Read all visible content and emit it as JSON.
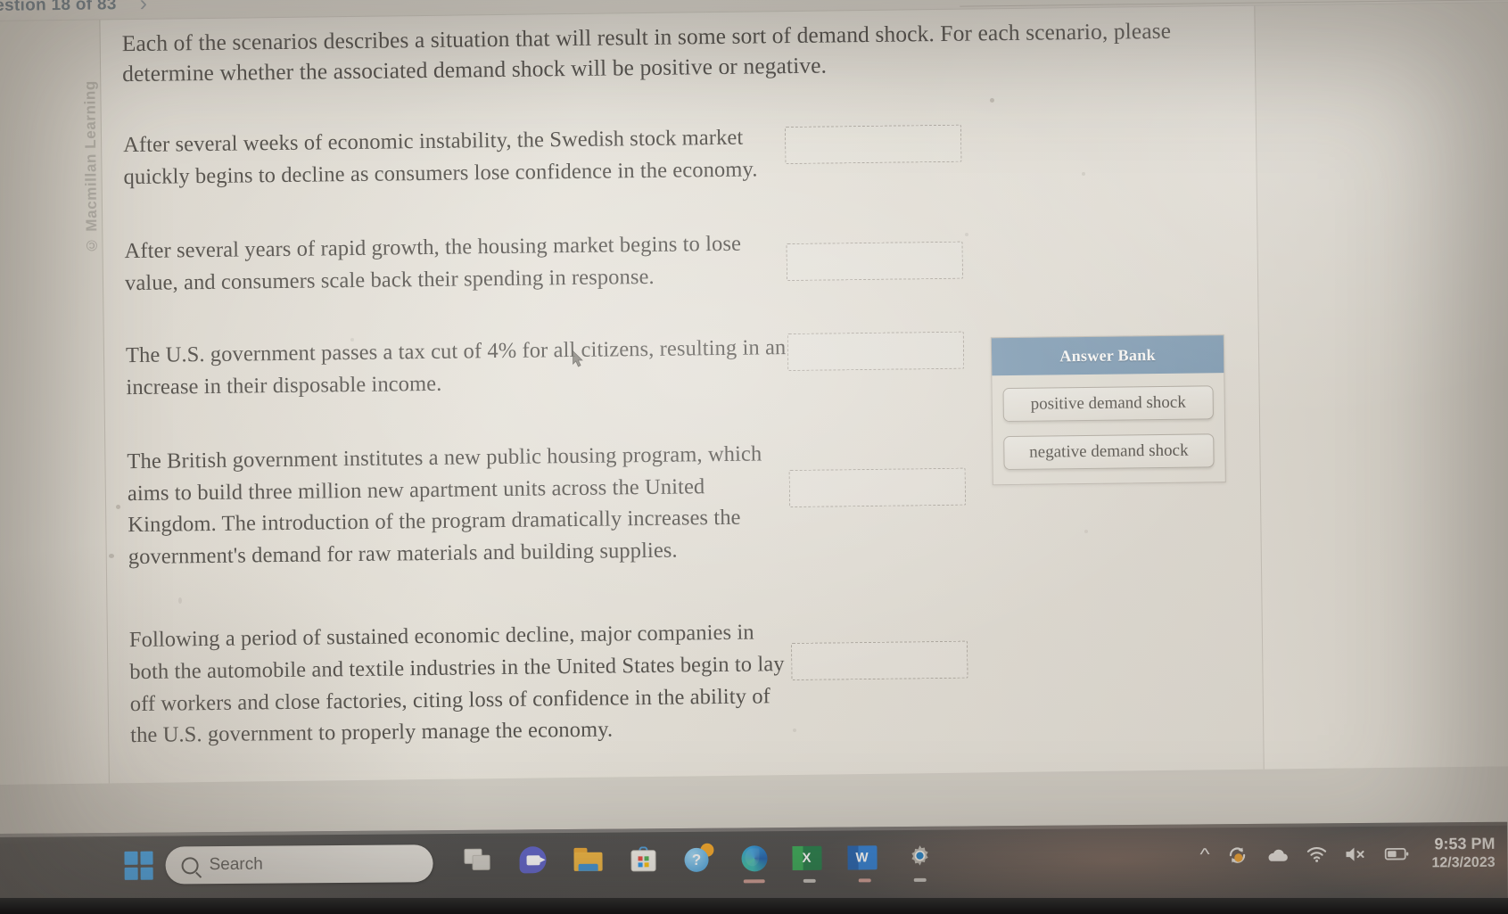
{
  "header": {
    "question_counter": "estion 18 of 83",
    "next_icon": "chevron-right-icon"
  },
  "watermark": "© Macmillan Learning",
  "question": {
    "intro": "Each of the scenarios describes a situation that will result in some sort of demand shock. For each scenario, please determine whether the associated demand shock will be positive or negative.",
    "scenarios": [
      {
        "text": "After several weeks of economic instability, the Swedish stock market quickly begins to decline as consumers lose confidence in the economy.",
        "answer": ""
      },
      {
        "text": "After several years of rapid growth, the housing market begins to lose value, and consumers scale back their spending in response.",
        "answer": ""
      },
      {
        "text": "The U.S. government passes a tax cut of 4% for all citizens, resulting in an increase in their disposable income.",
        "answer": ""
      },
      {
        "text": "The British government institutes a new public housing program, which aims to build three million new apartment units across the United Kingdom. The introduction of the program dramatically increases the government's demand for raw materials and building supplies.",
        "answer": ""
      },
      {
        "text": "Following a period of sustained economic decline, major companies in both the automobile and textile industries in the United States begin to lay off workers and close factories, citing loss of confidence in the ability of the U.S. government to properly manage the economy.",
        "answer": ""
      }
    ]
  },
  "answer_bank": {
    "title": "Answer Bank",
    "header_color": "#7e9cb5",
    "options": [
      "positive demand shock",
      "negative demand shock"
    ]
  },
  "taskbar": {
    "start_icon": "windows-logo-icon",
    "search": {
      "icon": "search-icon",
      "placeholder": "Search",
      "value": "Search"
    },
    "pinned": [
      {
        "name": "task-view-icon",
        "label": "Task View"
      },
      {
        "name": "chat-icon",
        "label": "Chat"
      },
      {
        "name": "file-explorer-icon",
        "label": "File Explorer"
      },
      {
        "name": "microsoft-store-icon",
        "label": "Microsoft Store"
      },
      {
        "name": "get-help-icon",
        "label": "Get Help"
      },
      {
        "name": "edge-icon",
        "label": "Microsoft Edge"
      },
      {
        "name": "excel-icon",
        "label": "Excel"
      },
      {
        "name": "word-icon",
        "label": "Word"
      },
      {
        "name": "settings-gear-icon",
        "label": "Settings"
      }
    ],
    "tray": {
      "overflow_icon": "chevron-up-icon",
      "update_icon": "sync-update-icon",
      "onedrive_icon": "cloud-icon",
      "wifi_icon": "wifi-icon",
      "volume_icon": "speaker-muted-icon",
      "battery_icon": "battery-icon",
      "time": "9:53 PM",
      "date": "12/3/2023"
    }
  }
}
